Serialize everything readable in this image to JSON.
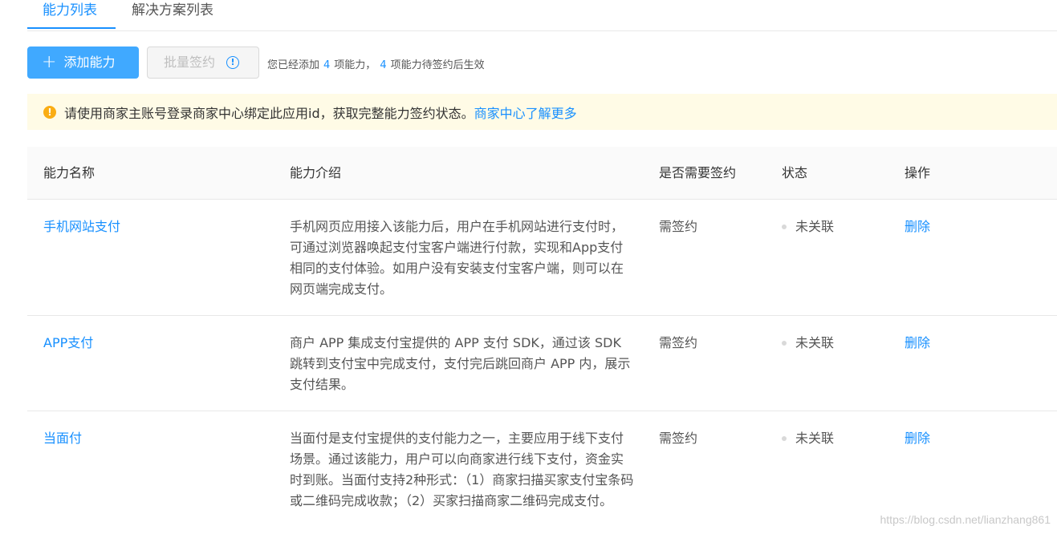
{
  "tabs": {
    "items": [
      {
        "label": "能力列表",
        "active": true
      },
      {
        "label": "解决方案列表",
        "active": false
      }
    ]
  },
  "toolbar": {
    "add_label": "添加能力",
    "batch_sign_label": "批量签约",
    "summary_prefix": "您已经添加",
    "added_count": "4",
    "summary_mid": "项能力，",
    "pending_count": "4",
    "summary_suffix": "项能力待签约后生效"
  },
  "alert": {
    "text": "请使用商家主账号登录商家中心绑定此应用id，获取完整能力签约状态。",
    "link1": "商家中心",
    "link2": "了解更多"
  },
  "table": {
    "headers": {
      "name": "能力名称",
      "desc": "能力介绍",
      "sign": "是否需要签约",
      "status": "状态",
      "op": "操作"
    },
    "rows": [
      {
        "name": "手机网站支付",
        "desc": "手机网页应用接入该能力后，用户在手机网站进行支付时，可通过浏览器唤起支付宝客户端进行付款，实现和App支付相同的支付体验。如用户没有安装支付宝客户端，则可以在网页端完成支付。",
        "sign": "需签约",
        "status": "未关联",
        "op": "删除"
      },
      {
        "name": "APP支付",
        "desc": "商户 APP 集成支付宝提供的 APP 支付 SDK，通过该 SDK 跳转到支付宝中完成支付，支付完后跳回商户 APP 内，展示支付结果。",
        "sign": "需签约",
        "status": "未关联",
        "op": "删除"
      },
      {
        "name": "当面付",
        "desc": "当面付是支付宝提供的支付能力之一，主要应用于线下支付场景。通过该能力，用户可以向商家进行线下支付，资金实时到账。当面付支持2种形式：（1）商家扫描买家支付宝条码或二维码完成收款；（2）买家扫描商家二维码完成支付。",
        "sign": "需签约",
        "status": "未关联",
        "op": "删除"
      }
    ]
  },
  "watermark": "https://blog.csdn.net/lianzhang861",
  "colors": {
    "primary": "#1890ff",
    "warning_bg": "#fffbe6",
    "warning_icon": "#faad14"
  }
}
